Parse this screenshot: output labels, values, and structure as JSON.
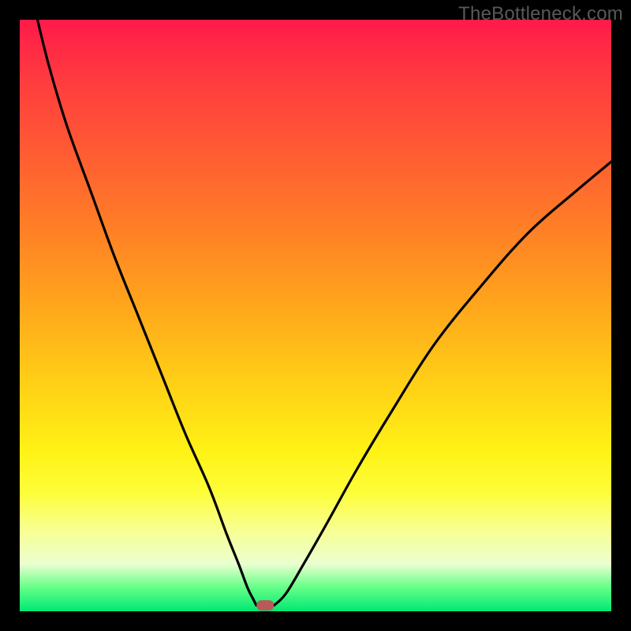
{
  "watermark": "TheBottleneck.com",
  "chart_data": {
    "type": "line",
    "title": "",
    "xlabel": "",
    "ylabel": "",
    "xlim": [
      0,
      100
    ],
    "ylim": [
      0,
      100
    ],
    "series": [
      {
        "name": "left-curve",
        "x": [
          3,
          5,
          8,
          12,
          16,
          20,
          24,
          28,
          32,
          35,
          37,
          38.5,
          39.5,
          40
        ],
        "values": [
          100,
          92,
          82,
          71,
          60,
          50,
          40,
          30,
          21,
          13,
          8,
          4,
          2,
          1
        ]
      },
      {
        "name": "right-curve",
        "x": [
          43,
          45,
          48,
          52,
          57,
          63,
          70,
          78,
          86,
          94,
          100
        ],
        "values": [
          1,
          3,
          8,
          15,
          24,
          34,
          45,
          55,
          64,
          71,
          76
        ]
      }
    ],
    "flat_segment": {
      "x": [
        40,
        43
      ],
      "y": 1
    },
    "marker": {
      "x": 41.5,
      "y": 1,
      "color": "#b85a5a"
    },
    "background_gradient": {
      "top": "#ff1a4a",
      "mid": "#ffe015",
      "bottom": "#00e874"
    }
  }
}
